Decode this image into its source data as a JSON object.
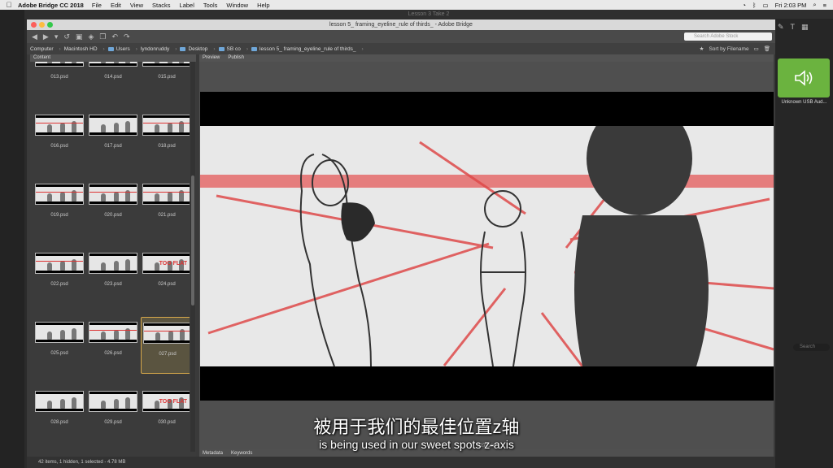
{
  "menubar": {
    "app_name": "Adobe Bridge CC 2018",
    "items": [
      "File",
      "Edit",
      "View",
      "Stacks",
      "Label",
      "Tools",
      "Window",
      "Help"
    ],
    "time": "Fri 2:03 PM"
  },
  "outer_title": "Lesson 3 Take 2",
  "window_title": "lesson 5_ framing_eyeline_rule of thirds_ - Adobe Bridge",
  "search_placeholder": "Search Adobe Stock",
  "path": [
    "Computer",
    "Macintosh HD",
    "Users",
    "lyndonruddy",
    "Desktop",
    "SB co",
    "lesson 5_ framing_eyeline_rule of thirds_"
  ],
  "sort_label": "Sort by Filename",
  "content_tab": "Content",
  "preview_tabs": [
    "Preview",
    "Publish"
  ],
  "metadata_tabs": [
    "Metadata",
    "Keywords"
  ],
  "thumbnails": [
    {
      "name": "013.psd",
      "tf": false,
      "red": false
    },
    {
      "name": "014.psd",
      "tf": false,
      "red": false
    },
    {
      "name": "015.psd",
      "tf": false,
      "red": false
    },
    {
      "name": "016.psd",
      "tf": false,
      "red": true
    },
    {
      "name": "017.psd",
      "tf": false,
      "red": false
    },
    {
      "name": "018.psd",
      "tf": false,
      "red": true
    },
    {
      "name": "019.psd",
      "tf": false,
      "red": true
    },
    {
      "name": "020.psd",
      "tf": false,
      "red": true
    },
    {
      "name": "021.psd",
      "tf": false,
      "red": true
    },
    {
      "name": "022.psd",
      "tf": false,
      "red": true
    },
    {
      "name": "023.psd",
      "tf": false,
      "red": false
    },
    {
      "name": "024.psd",
      "tf": true,
      "red": false
    },
    {
      "name": "025.psd",
      "tf": false,
      "red": false
    },
    {
      "name": "026.psd",
      "tf": false,
      "red": true
    },
    {
      "name": "027.psd",
      "tf": false,
      "red": true,
      "selected": true
    },
    {
      "name": "028.psd",
      "tf": false,
      "red": false
    },
    {
      "name": "029.psd",
      "tf": false,
      "red": false
    },
    {
      "name": "030.psd",
      "tf": true,
      "red": false
    }
  ],
  "too_flat_label": "TOO FLAT",
  "preview_filename": "027.psd",
  "status_text": "42 items, 1 hidden, 1 selected - 4.78 MB",
  "subtitle_cn": "被用于我们的最佳位置z轴",
  "subtitle_en": "is being used in our sweet spots z-axis",
  "audio_device": "Unknown USB Aud...",
  "right_search_placeholder": "Search",
  "accent_color": "#6bb33f",
  "selection_color": "#d8a94b"
}
